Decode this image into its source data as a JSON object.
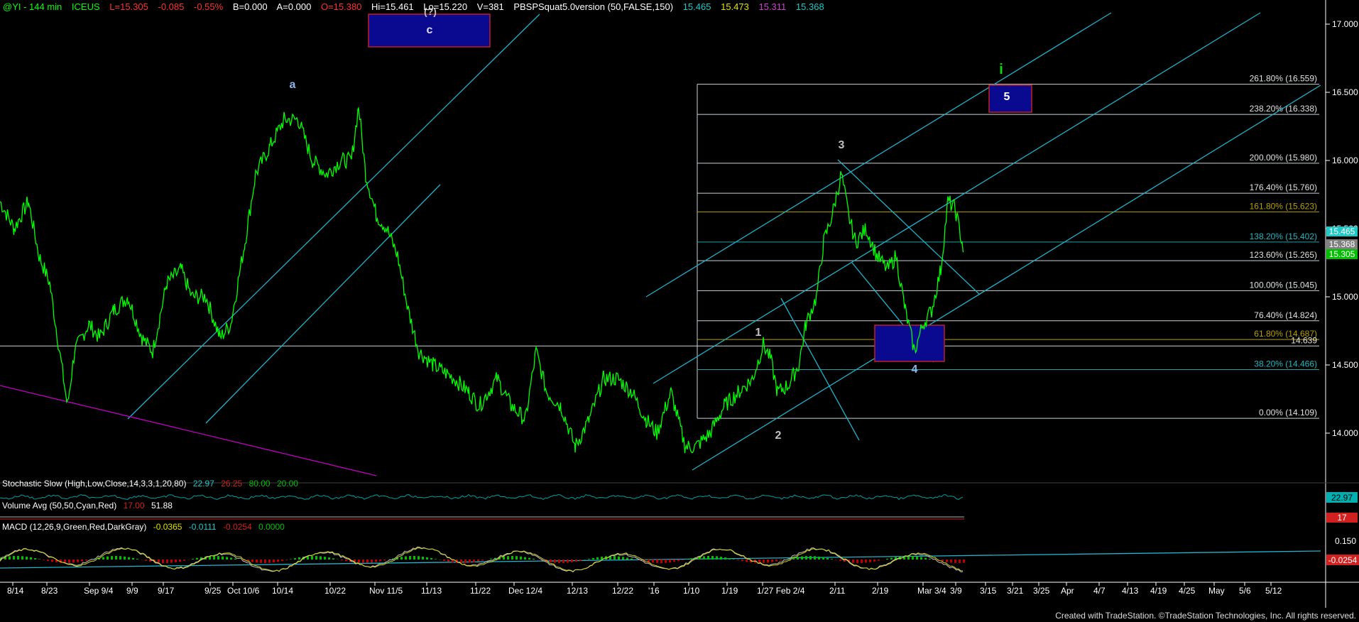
{
  "header": {
    "symbol": "@YI - 144 min",
    "exchange": "ICEUS",
    "last": "L=15.305",
    "change": "-0.085",
    "pct": "-0.55%",
    "bid": "B=0.000",
    "ask": "A=0.000",
    "open": "O=15.380",
    "hi": "Hi=15.461",
    "lo": "Lo=15.220",
    "vol": "V=381",
    "study": "PBSPSquat5.0version (50,FALSE,150)",
    "v1": "15.465",
    "v2": "15.473",
    "v3": "15.311",
    "v4": "15.368"
  },
  "colors": {
    "background": "#000000",
    "price": "#00ff00",
    "channel": "#20b2c8",
    "fib": "#c8d2d8",
    "fib_gold": "#b8a000",
    "target_box": "#0a0a90",
    "magenta": "#c000c0"
  },
  "price_axis": [
    "17.000",
    "16.500",
    "16.000",
    "15.500",
    "15.000",
    "14.500",
    "14.000"
  ],
  "price_tags": [
    {
      "text": "15.465",
      "color": "#20c8c8"
    },
    {
      "text": "15.368",
      "color": "#808080"
    },
    {
      "text": "15.305",
      "color": "#00c000"
    }
  ],
  "wave_labels": [
    {
      "text": "a",
      "color": "#8fb4e8"
    },
    {
      "text": "c",
      "color": "#e0e0ff"
    },
    {
      "text": "(?)",
      "color": "#c0c0c0"
    },
    {
      "text": "1",
      "color": "#c0c0c0"
    },
    {
      "text": "2",
      "color": "#c0c0c0"
    },
    {
      "text": "3",
      "color": "#c0c0c0"
    },
    {
      "text": "4",
      "color": "#8fb4e8"
    },
    {
      "text": "5",
      "color": "#ffffff"
    },
    {
      "text": "i",
      "color": "#00e000"
    }
  ],
  "fib_labels": [
    "261.80% (16.559)",
    "238.20% (16.338)",
    "200.00% (15.980)",
    "176.40% (15.760)",
    "161.80% (15.623)",
    "138.20% (15.402)",
    "123.60% (15.265)",
    "100.00% (15.045)",
    "76.40% (14.824)",
    "61.80% (14.687)",
    "14.639",
    "38.20% (14.466)",
    "0.00% (14.109)"
  ],
  "indicators": {
    "stoch": {
      "label": "Stochastic Slow (High,Low,Close,14,3,3,1,20,80)",
      "v1": "22.97",
      "v2": "26.25",
      "v3": "80.00",
      "v4": "20.00",
      "tag": "22.97"
    },
    "volavg": {
      "label": "Volume Avg (50,50,Cyan,Red)",
      "v1": "17.00",
      "v2": "51.88",
      "tag": "17"
    },
    "macd": {
      "label": "MACD (12,26,9,Green,Red,DarkGray)",
      "v1": "-0.0365",
      "v2": "-0.0111",
      "v3": "-0.0254",
      "v4": "0.0000",
      "axis": "0.150",
      "tag": "-0.0254"
    }
  },
  "date_axis": [
    "8/14",
    "8/23",
    "Sep 9/4",
    "9/9",
    "9/17",
    "9/25",
    "Oct 10/6",
    "10/14",
    "10/22",
    "Nov 11/5",
    "11/13",
    "11/22",
    "Dec 12/4",
    "12/13",
    "12/22",
    "'16",
    "1/10",
    "1/19",
    "1/27 Feb 2/4",
    "2/11",
    "2/19",
    "Mar 3/4",
    "3/9",
    "3/15",
    "3/21",
    "3/25",
    "Apr",
    "4/7",
    "4/13",
    "4/19",
    "4/25",
    "May",
    "5/6",
    "5/12"
  ],
  "footer": "Created with TradeStation. ©TradeStation Technologies, Inc. All rights reserved.",
  "chart_data": {
    "type": "line",
    "title": "@YI - 144 min",
    "ylim": [
      13.6,
      17.2
    ],
    "x": [
      "8/14",
      "8/23",
      "9/4",
      "9/9",
      "9/17",
      "9/25",
      "10/6",
      "10/14",
      "10/22",
      "11/5",
      "11/13",
      "11/22",
      "12/4",
      "12/13",
      "12/22",
      "'16",
      "1/10",
      "1/19",
      "1/27",
      "2/4",
      "2/11",
      "2/19",
      "3/4",
      "3/9"
    ],
    "series": [
      {
        "values": [
          15.7,
          14.2,
          14.7,
          14.9,
          15.1,
          14.8,
          15.6,
          16.3,
          15.9,
          15.5,
          14.6,
          14.2,
          14.4,
          13.7,
          14.3,
          14.0,
          13.9,
          14.2,
          14.6,
          15.0,
          16.0,
          15.4,
          14.7,
          15.3
        ]
      }
    ],
    "fib_levels": [
      16.559,
      16.338,
      15.98,
      15.76,
      15.623,
      15.402,
      15.265,
      15.045,
      14.824,
      14.687,
      14.639,
      14.466,
      14.109
    ]
  }
}
